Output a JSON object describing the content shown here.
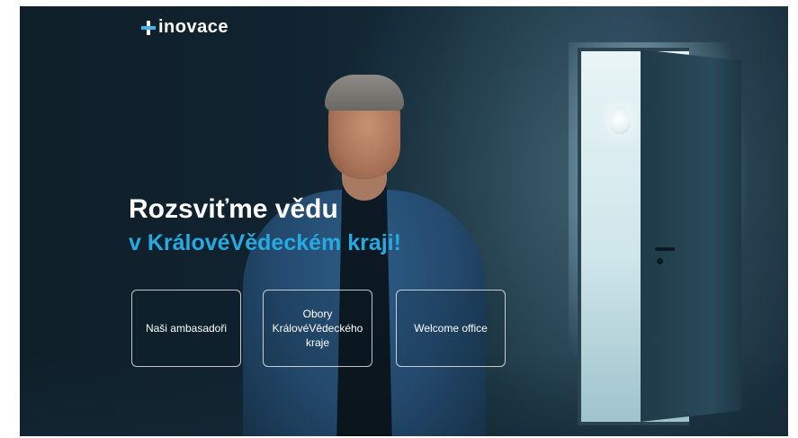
{
  "brand": {
    "logo_text": "inovace",
    "logo_icon": "plus-icon"
  },
  "hero": {
    "headline": "Rozsviťme vědu",
    "subline": "v KrálovéVědeckém kraji!",
    "accent_color": "#27a9e1"
  },
  "tiles": [
    {
      "label": "Naši ambasadoři"
    },
    {
      "label_lines": [
        "Obory",
        "KrálovéVědeckého",
        "kraje"
      ]
    },
    {
      "label": "Welcome office"
    }
  ]
}
